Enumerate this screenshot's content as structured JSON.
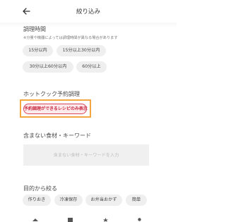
{
  "header": {
    "title": "絞り込み"
  },
  "cooking_time": {
    "title": "調理時間",
    "note": "※分量や機器によっては調理時間が異なる場合があります",
    "options": [
      "15分以内",
      "15分以上30分以内",
      "30分以上60分以内",
      "60分以上"
    ]
  },
  "hotcook": {
    "title": "ホットクック予約調理",
    "chip_label": "予約調理ができるレシピのみ表示"
  },
  "exclude": {
    "title": "含まない食材・キーワード",
    "placeholder": "含まない食材・キーワードを入力",
    "value": ""
  },
  "purpose": {
    "title": "目的から絞る",
    "options": [
      "作りおき",
      "冷凍保存",
      "お弁当おかず",
      "簡単"
    ]
  },
  "icons": {
    "back": "arrow-left-icon",
    "bottom_nav": [
      "home-icon",
      "recipe-icon",
      "favorite-icon",
      "user-icon"
    ]
  }
}
